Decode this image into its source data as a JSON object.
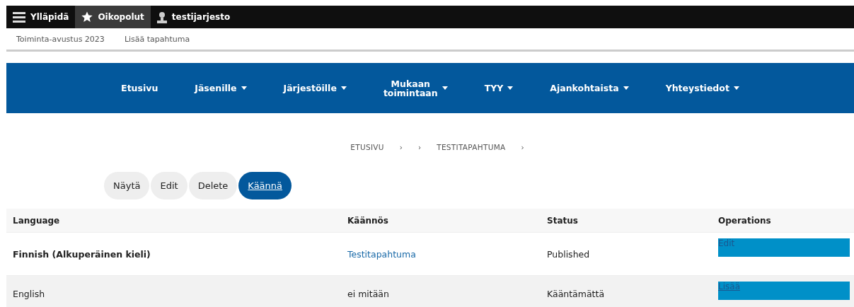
{
  "toolbar": {
    "items": [
      {
        "label": "Ylläpidä",
        "selected": false
      },
      {
        "label": "Oikopolut",
        "selected": true
      },
      {
        "label": "testijarjesto",
        "selected": false
      }
    ]
  },
  "tray": {
    "links": [
      "Toiminta-avustus 2023",
      "Lisää tapahtuma"
    ]
  },
  "nav": {
    "items": [
      {
        "label": "Etusivu",
        "dropdown": false
      },
      {
        "label": "Jäsenille",
        "dropdown": true
      },
      {
        "label": "Järjestöille",
        "dropdown": true
      },
      {
        "label": "Mukaan toimintaan",
        "dropdown": true
      },
      {
        "label": "TYY",
        "dropdown": true
      },
      {
        "label": "Ajankohtaista",
        "dropdown": true
      },
      {
        "label": "Yhteystiedot",
        "dropdown": true
      }
    ]
  },
  "breadcrumb": [
    {
      "kind": "crumb",
      "text": "ETUSIVU"
    },
    {
      "kind": "separator",
      "text": "›"
    },
    {
      "kind": "separator",
      "text": "›"
    },
    {
      "kind": "crumb",
      "text": "TESTITAPAHTUMA"
    },
    {
      "kind": "separator",
      "text": "›"
    }
  ],
  "tabs": [
    {
      "label": "Näytä",
      "selected": false
    },
    {
      "label": "Edit",
      "selected": false
    },
    {
      "label": "Delete",
      "selected": false
    },
    {
      "label": "Käännä",
      "selected": true
    }
  ],
  "table": {
    "columns": [
      "Language",
      "Käännös",
      "Status",
      "Operations"
    ],
    "rows": [
      {
        "language": "Finnish (Alkuperäinen kieli)",
        "original": true,
        "translation": {
          "kind": "link",
          "text": "Testitapahtuma"
        },
        "status": "Published",
        "operation": {
          "label": "Edit",
          "underlined": false
        }
      },
      {
        "language": "English",
        "original": false,
        "translation": {
          "kind": "text",
          "text": "ei mitään"
        },
        "status": "Kääntämättä",
        "operation": {
          "label": "Lisää",
          "underlined": true
        }
      }
    ]
  }
}
